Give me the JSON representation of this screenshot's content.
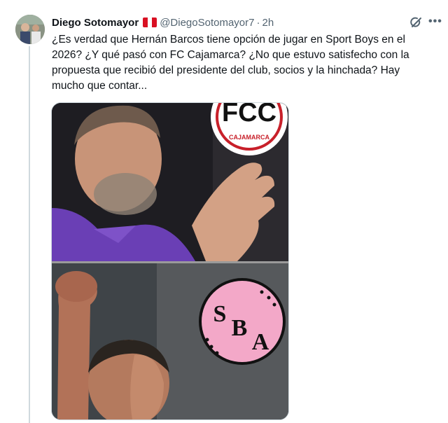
{
  "tweet": {
    "author_name": "Diego Sotomayor",
    "flag_icon": "peru-flag-icon",
    "handle": "@DiegoSotomayor7",
    "separator": "·",
    "time": "2h",
    "text_lines": [
      "¿Es verdad que Hernán Barcos tiene opción de jugar en Sport Boys en el",
      "2026? ¿Y qué pasó con FC Cajamarca? ¿No que estuvo satisfecho con la",
      "propuesta que recibió del presidente del club, socios y la hinchada? Hay",
      "mucho que contar..."
    ],
    "more_icon": "more-options-icon",
    "grok_icon": "grok-icon"
  },
  "media": {
    "top_logo_letters": "FCC",
    "top_logo_text": "CAJAMARCA",
    "bottom_logo_letters": [
      "S",
      "B",
      "A"
    ],
    "colors": {
      "purple_shirt": "#6a3fb5",
      "pink_badge": "#f3a8c8",
      "badge_red": "#c8202a",
      "peru_red": "#d91023"
    }
  }
}
